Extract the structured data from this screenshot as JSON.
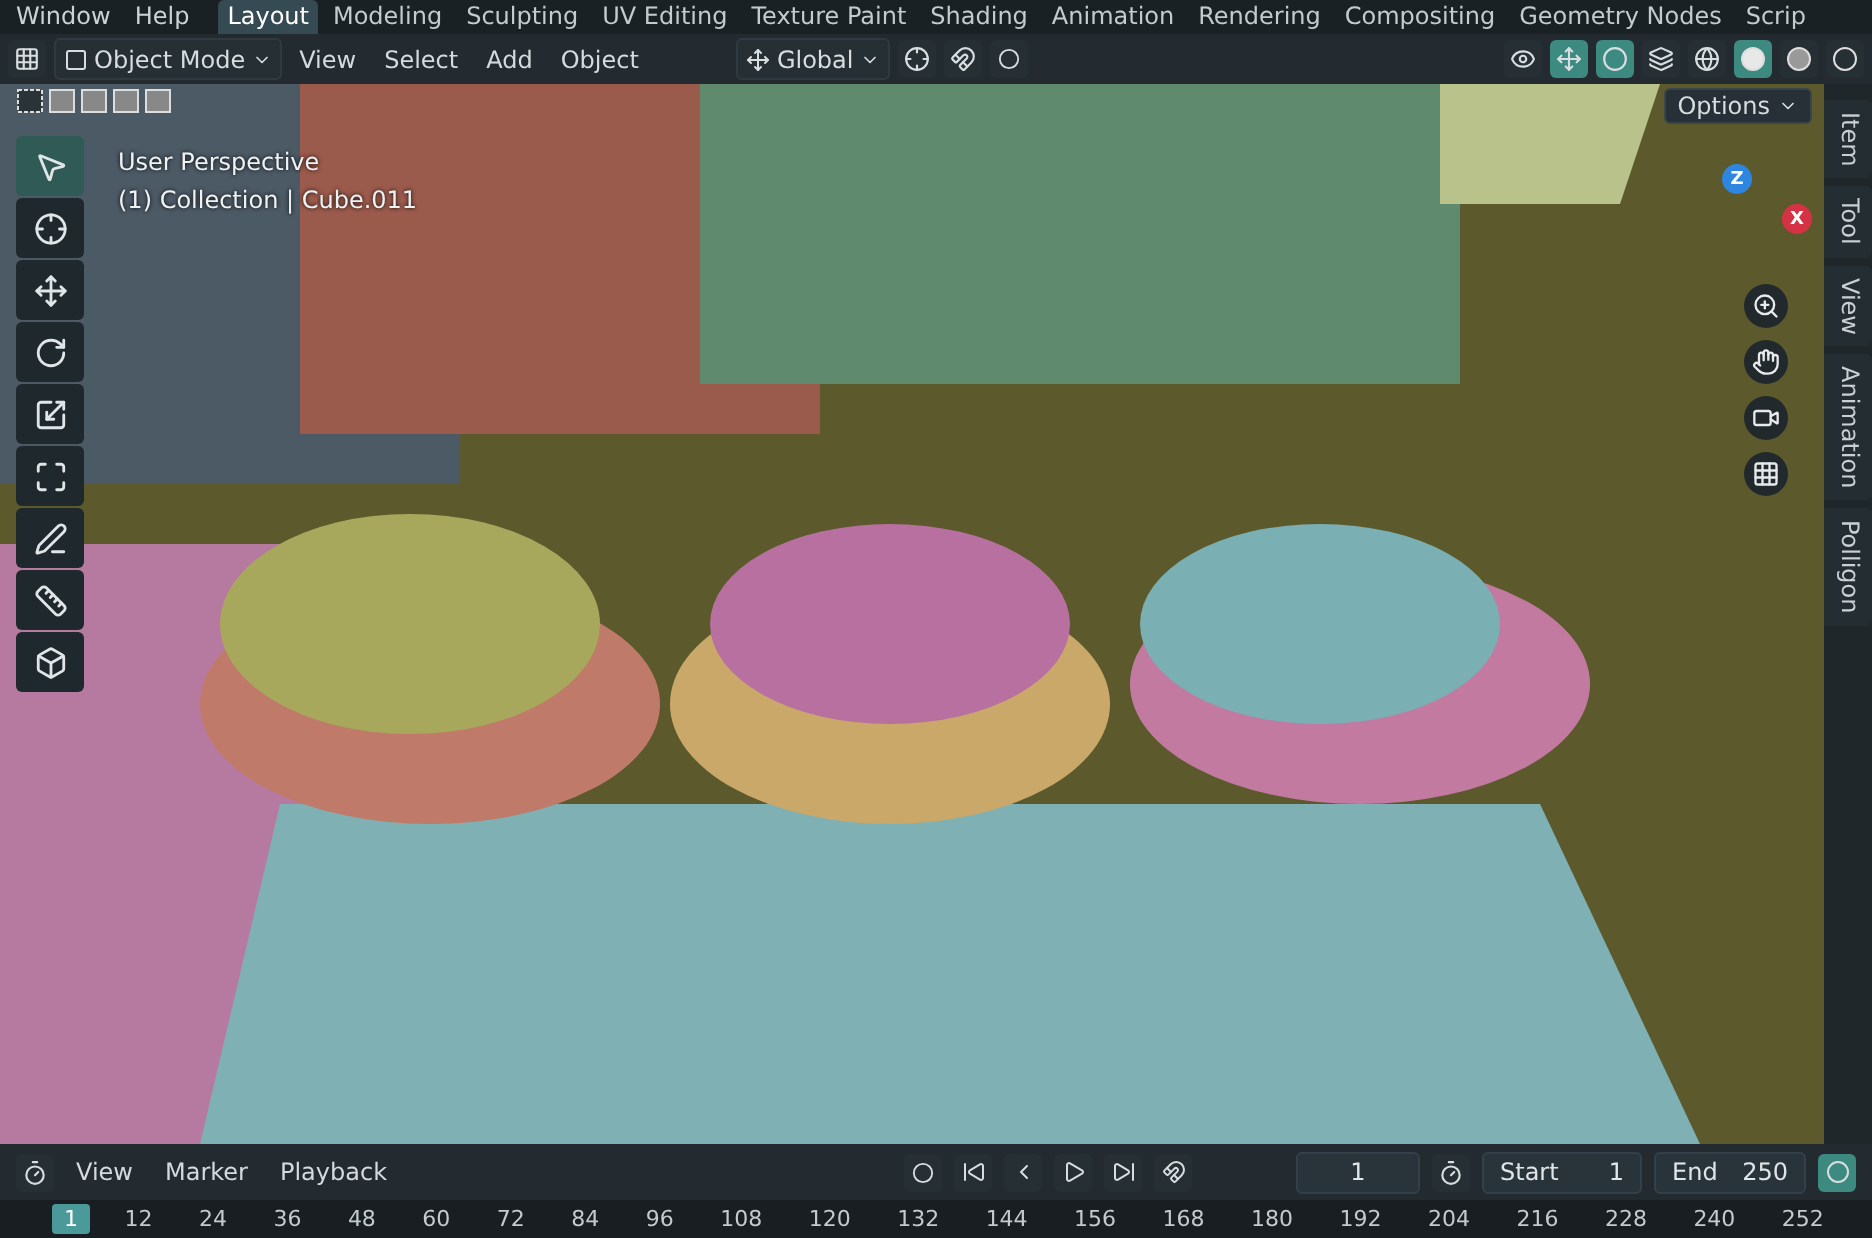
{
  "top_menu": [
    "Window",
    "Help"
  ],
  "workspaces": [
    {
      "label": "Layout",
      "selected": true
    },
    {
      "label": "Modeling",
      "selected": false
    },
    {
      "label": "Sculpting",
      "selected": false
    },
    {
      "label": "UV Editing",
      "selected": false
    },
    {
      "label": "Texture Paint",
      "selected": false
    },
    {
      "label": "Shading",
      "selected": false
    },
    {
      "label": "Animation",
      "selected": false
    },
    {
      "label": "Rendering",
      "selected": false
    },
    {
      "label": "Compositing",
      "selected": false
    },
    {
      "label": "Geometry Nodes",
      "selected": false
    },
    {
      "label": "Scrip",
      "selected": false
    }
  ],
  "header": {
    "mode": "Object Mode",
    "menus": [
      "View",
      "Select",
      "Add",
      "Object"
    ],
    "orientation": "Global",
    "shading_modes": [
      {
        "kind": "wireframe",
        "selected": false
      },
      {
        "kind": "solid",
        "selected": true
      },
      {
        "kind": "material",
        "selected": false
      },
      {
        "kind": "rendered",
        "selected": false
      }
    ],
    "options": "Options"
  },
  "viewport": {
    "view_name": "User Perspective",
    "collection": "(1) Collection | Cube.011",
    "gizmo_axes": [
      {
        "label": "Z",
        "color": "#2f86e0"
      },
      {
        "label": "X",
        "color": "#d63245"
      }
    ]
  },
  "tools": [
    {
      "kind": "select",
      "selected": true
    },
    {
      "kind": "cursor",
      "selected": false
    },
    {
      "kind": "move",
      "selected": false
    },
    {
      "kind": "rotate",
      "selected": false
    },
    {
      "kind": "scale",
      "selected": false
    },
    {
      "kind": "transform",
      "selected": false
    },
    {
      "kind": "annotate",
      "selected": false
    },
    {
      "kind": "measure",
      "selected": false
    },
    {
      "kind": "add-cube",
      "selected": false
    }
  ],
  "side_tabs": [
    {
      "label": "Item",
      "selected": false
    },
    {
      "label": "Tool",
      "selected": false
    },
    {
      "label": "View",
      "selected": false
    },
    {
      "label": "Animation",
      "selected": false
    },
    {
      "label": "Polligon",
      "selected": false
    }
  ],
  "timeline": {
    "menus": [
      "View",
      "Marker",
      "Playback"
    ],
    "current_frame": "1",
    "start_label": "Start",
    "start": "1",
    "end_label": "End",
    "end": "250"
  },
  "ruler": [
    {
      "label": "1",
      "selected": true
    },
    {
      "label": "12",
      "selected": false
    },
    {
      "label": "24",
      "selected": false
    },
    {
      "label": "36",
      "selected": false
    },
    {
      "label": "48",
      "selected": false
    },
    {
      "label": "60",
      "selected": false
    },
    {
      "label": "72",
      "selected": false
    },
    {
      "label": "84",
      "selected": false
    },
    {
      "label": "96",
      "selected": false
    },
    {
      "label": "108",
      "selected": false
    },
    {
      "label": "120",
      "selected": false
    },
    {
      "label": "132",
      "selected": false
    },
    {
      "label": "144",
      "selected": false
    },
    {
      "label": "156",
      "selected": false
    },
    {
      "label": "168",
      "selected": false
    },
    {
      "label": "180",
      "selected": false
    },
    {
      "label": "192",
      "selected": false
    },
    {
      "label": "204",
      "selected": false
    },
    {
      "label": "216",
      "selected": false
    },
    {
      "label": "228",
      "selected": false
    },
    {
      "label": "240",
      "selected": false
    },
    {
      "label": "252",
      "selected": false
    }
  ]
}
